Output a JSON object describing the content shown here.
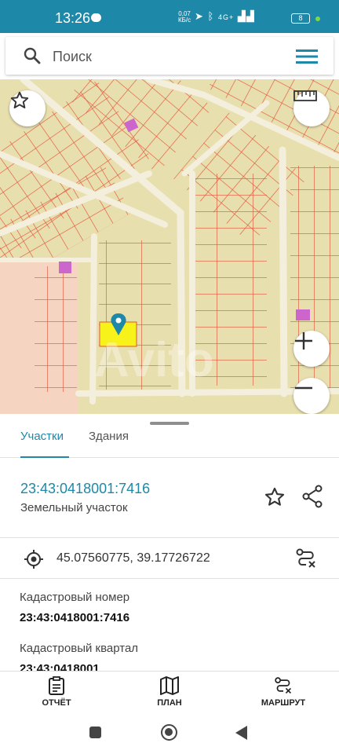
{
  "status_bar": {
    "time": "13:26",
    "speed_value": "0,07",
    "speed_unit": "КБ/с",
    "signal_text": "4G+",
    "battery": "8"
  },
  "search": {
    "placeholder": "Поиск"
  },
  "map": {
    "watermark": "Avito",
    "selected_plot_color": "#f7f21a",
    "marker_color": "#1e88a8",
    "parcel_line_color": "#e2543c",
    "land_color": "#e8dfae",
    "building_color": "#cc66cc"
  },
  "tabs": [
    {
      "label": "Участки",
      "active": true
    },
    {
      "label": "Здания",
      "active": false
    }
  ],
  "plot": {
    "cadastral_link": "23:43:0418001:7416",
    "type": "Земельный участок",
    "coordinates": "45.07560775, 39.17726722",
    "fields": [
      {
        "label": "Кадастровый номер",
        "value": "23:43:0418001:7416"
      },
      {
        "label": "Кадастровый квартал",
        "value": "23:43:0418001"
      }
    ]
  },
  "actions": [
    {
      "label": "ОТЧЁТ",
      "icon": "clipboard-icon"
    },
    {
      "label": "ПЛАН",
      "icon": "map-icon"
    },
    {
      "label": "МАРШРУТ",
      "icon": "route-icon"
    }
  ],
  "accent_color": "#1e88a8"
}
